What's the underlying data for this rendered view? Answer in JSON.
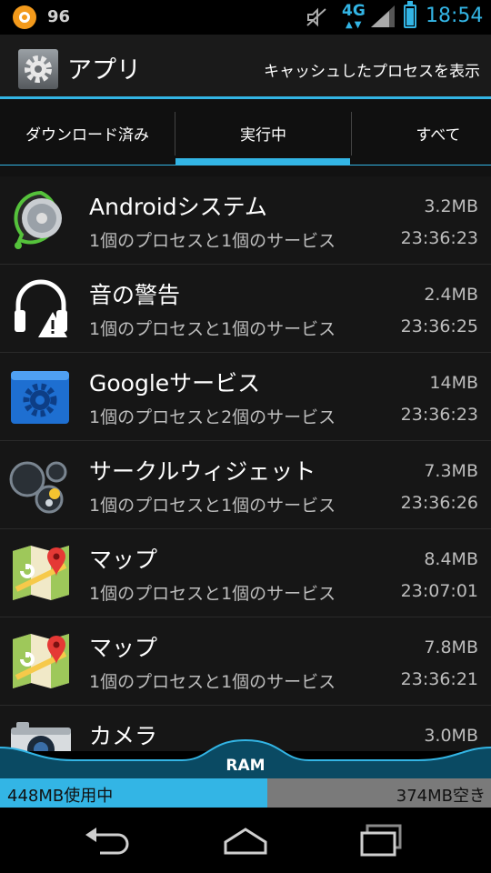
{
  "status_bar": {
    "notification_count": "96",
    "network_type": "4G",
    "time": "18:54",
    "battery_level": 0.9,
    "accent_color": "#33b5e5",
    "icons": [
      "app-notification-icon",
      "vibrate-mute-icon",
      "signal-icon",
      "battery-icon"
    ]
  },
  "action_bar": {
    "title": "アプリ",
    "action_label": "キャッシュしたプロセスを表示",
    "icon": "settings-gear-icon"
  },
  "tabs": [
    {
      "label": "ダウンロード済み",
      "selected": false
    },
    {
      "label": "実行中",
      "selected": true
    },
    {
      "label": "すべて",
      "selected": false
    }
  ],
  "running_apps": [
    {
      "name": "Androidシステム",
      "detail": "1個のプロセスと1個のサービス",
      "size": "3.2MB",
      "time": "23:36:23",
      "icon": "android-system-icon"
    },
    {
      "name": "音の警告",
      "detail": "1個のプロセスと1個のサービス",
      "size": "2.4MB",
      "time": "23:36:25",
      "icon": "headphones-warning-icon"
    },
    {
      "name": "Googleサービス",
      "detail": "1個のプロセスと2個のサービス",
      "size": "14MB",
      "time": "23:36:23",
      "icon": "google-services-icon"
    },
    {
      "name": "サークルウィジェット",
      "detail": "1個のプロセスと1個のサービス",
      "size": "7.3MB",
      "time": "23:36:26",
      "icon": "circle-widget-icon"
    },
    {
      "name": "マップ",
      "detail": "1個のプロセスと1個のサービス",
      "size": "8.4MB",
      "time": "23:07:01",
      "icon": "maps-icon"
    },
    {
      "name": "マップ",
      "detail": "1個のプロセスと1個のサービス",
      "size": "7.8MB",
      "time": "23:36:21",
      "icon": "maps-icon"
    },
    {
      "name": "カメラ",
      "detail": "",
      "size": "3.0MB",
      "time": "",
      "icon": "camera-icon"
    }
  ],
  "ram": {
    "label": "RAM",
    "used_label": "448MB使用中",
    "free_label": "374MB空き",
    "used_fraction": 0.545
  },
  "nav_bar": {
    "icons": [
      "back-icon",
      "home-icon",
      "recent-apps-icon"
    ]
  }
}
